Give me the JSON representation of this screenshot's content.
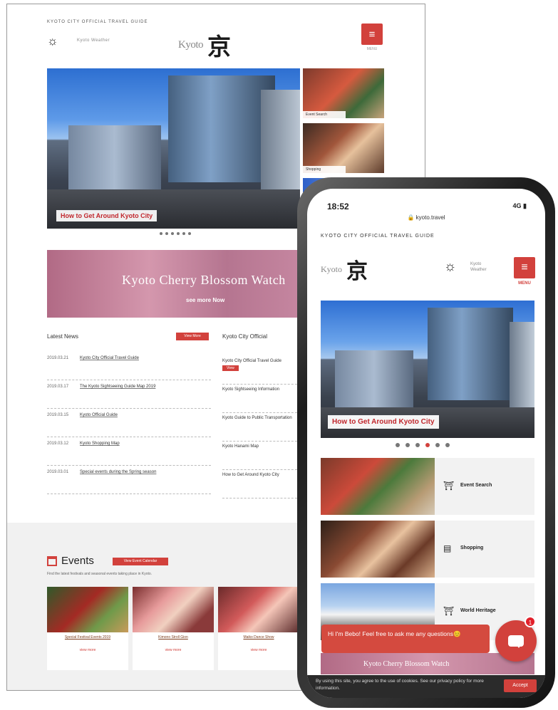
{
  "desktop": {
    "tagline": "KYOTO CITY OFFICIAL TRAVEL GUIDE",
    "weather_icon": "sun-icon",
    "weather_text": "Kyoto Weather",
    "logo_word": "Kyoto",
    "logo_kanji": "京",
    "menu_label": "MENU",
    "hero_caption": "How to Get Around Kyoto City",
    "side_items": [
      {
        "label": "Event Search"
      },
      {
        "label": "Shopping"
      }
    ],
    "banner_title": "Kyoto Cherry Blossom Watch",
    "banner_sub": "see more Now",
    "latest_news_title": "Latest News",
    "latest_news_more": "View More",
    "news": [
      {
        "date": "2019.03.21",
        "text": "Kyoto City Official Travel Guide"
      },
      {
        "date": "2019.03.17",
        "text": "The Kyoto Sightseeing Guide Map 2019"
      },
      {
        "date": "2019.03.15",
        "text": "Kyoto Official Guide"
      },
      {
        "date": "2019.03.12",
        "text": "Kyoto Shopping Map"
      },
      {
        "date": "2019.03.01",
        "text": "Special events during the Spring season"
      }
    ],
    "city_news_title": "Kyoto City Official",
    "city_news": [
      {
        "text": "Kyoto City Official Travel Guide",
        "tag": "View"
      },
      {
        "text": "Kyoto Sightseeing Information"
      },
      {
        "text": "Kyoto Guide to Public Transportation"
      },
      {
        "text": "Kyoto Hanami Map"
      },
      {
        "text": "How to Get Around Kyoto City"
      }
    ],
    "events_title": "Events",
    "events_button": "View Event Calendar",
    "events_desc": "Find the latest festivals and seasonal events taking place in Kyoto.",
    "event_cards": [
      {
        "title": "Special Festival Events 2019",
        "more": "view more"
      },
      {
        "title": "Kimono Stroll Gion",
        "more": "view more"
      },
      {
        "title": "Maiko Dance Show",
        "more": "view more"
      }
    ]
  },
  "phone": {
    "time": "18:52",
    "signal": "4G",
    "url": "kyoto.travel",
    "tagline": "KYOTO CITY OFFICIAL TRAVEL GUIDE",
    "logo_word": "Kyoto",
    "logo_kanji": "京",
    "weather_icon": "sun-icon",
    "temp_line1": "Kyoto",
    "temp_line2": "Weather",
    "menu_label": "MENU",
    "hero_caption": "How to Get Around Kyoto City",
    "items": [
      {
        "label": "Event Search",
        "icon": "calendar-icon"
      },
      {
        "label": "Shopping",
        "icon": "shop-icon"
      },
      {
        "label": "World Heritage",
        "icon": "temple-icon"
      }
    ],
    "banner_title": "Kyoto Cherry Blossom Watch",
    "chat_message": "Hi I'm Bebo! Feel free to ask me any questions😊",
    "chat_badge": "1",
    "cookie_text": "By using this site, you agree to the use of cookies. See our privacy policy for more information.",
    "cookie_accept": "Accept"
  }
}
